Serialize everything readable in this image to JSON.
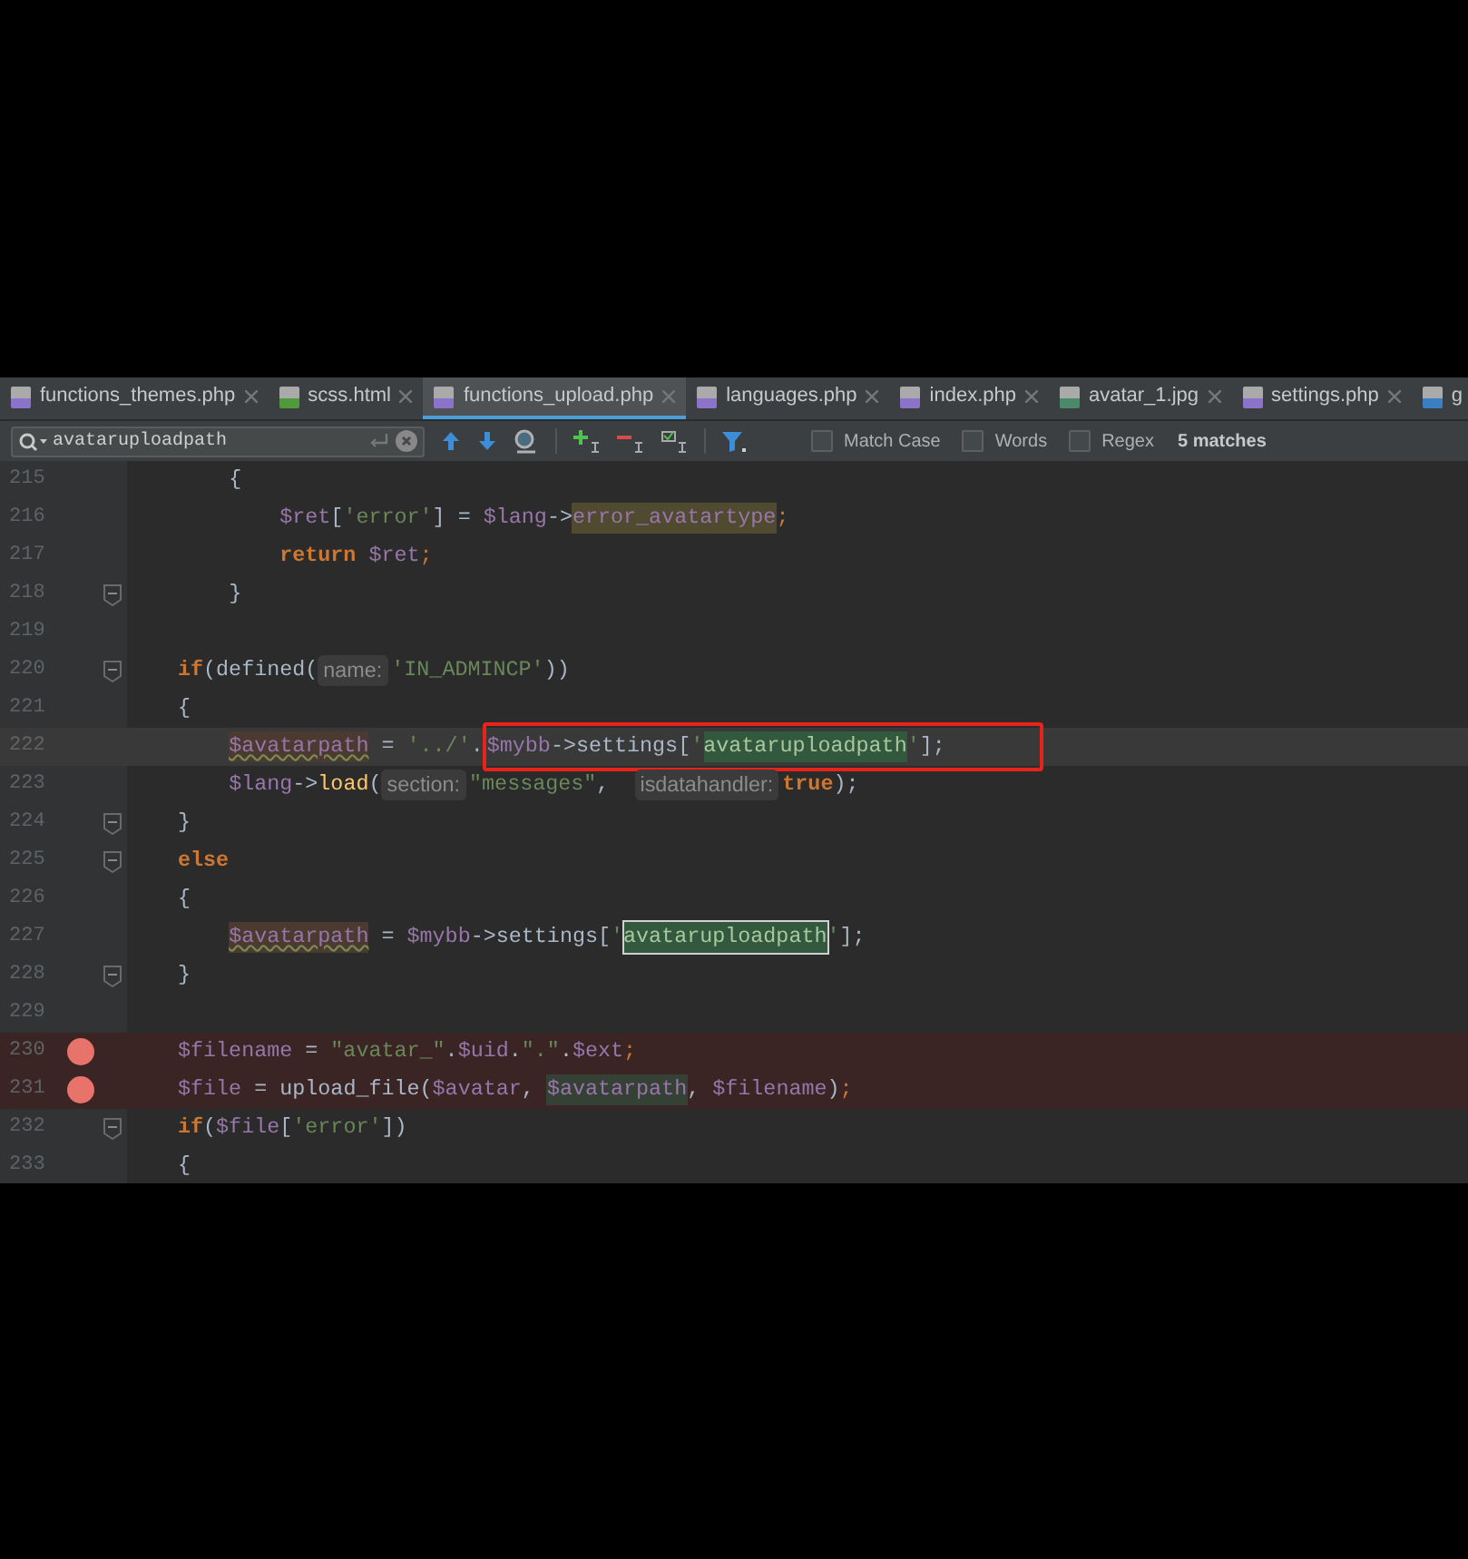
{
  "tabs": [
    {
      "label": "functions_themes.php",
      "kind": "php",
      "selected": false
    },
    {
      "label": "scss.html",
      "kind": "html",
      "selected": false
    },
    {
      "label": "functions_upload.php",
      "kind": "php",
      "selected": true
    },
    {
      "label": "languages.php",
      "kind": "php",
      "selected": false
    },
    {
      "label": "index.php",
      "kind": "php",
      "selected": false
    },
    {
      "label": "avatar_1.jpg",
      "kind": "image",
      "selected": false
    },
    {
      "label": "settings.php",
      "kind": "php",
      "selected": false
    },
    {
      "label": "g",
      "kind": "css",
      "selected": false
    }
  ],
  "find_bar": {
    "query": "avataruploadpath",
    "options": [
      {
        "label": "Match Case",
        "checked": false
      },
      {
        "label": "Words",
        "checked": false
      },
      {
        "label": "Regex",
        "checked": false
      }
    ],
    "matches": "5 matches"
  },
  "code": [
    {
      "number": "215",
      "fold": false,
      "breakpoint": false,
      "current": false,
      "tokens": [
        {
          "kind": "text",
          "text": "    {"
        }
      ]
    },
    {
      "number": "216",
      "fold": false,
      "breakpoint": false,
      "current": false,
      "tokens": [
        {
          "kind": "var",
          "text": "        $ret"
        },
        {
          "kind": "text",
          "text": "["
        },
        {
          "kind": "string",
          "text": "'error'"
        },
        {
          "kind": "text",
          "text": "] = "
        },
        {
          "kind": "var",
          "text": "$lang"
        },
        {
          "kind": "text",
          "text": "->"
        },
        {
          "kind": "unresolved",
          "text": "error_avatartype"
        },
        {
          "kind": "punct",
          "text": ";"
        }
      ]
    },
    {
      "number": "217",
      "fold": false,
      "breakpoint": false,
      "current": false,
      "tokens": [
        {
          "kind": "keyword",
          "text": "        return"
        },
        {
          "kind": "var",
          "text": " $ret"
        },
        {
          "kind": "punct",
          "text": ";"
        }
      ]
    },
    {
      "number": "218",
      "fold": true,
      "breakpoint": false,
      "current": false,
      "tokens": [
        {
          "kind": "text",
          "text": "    }"
        }
      ]
    },
    {
      "number": "219",
      "fold": false,
      "breakpoint": false,
      "current": false
    },
    {
      "number": "220",
      "fold": true,
      "breakpoint": false,
      "current": false,
      "tokens": [
        {
          "kind": "keyword",
          "text": "if"
        },
        {
          "kind": "text",
          "text": "(defined("
        },
        {
          "kind": "hint",
          "text": "name:"
        },
        {
          "kind": "string",
          "text": "'IN_ADMINCP'"
        },
        {
          "kind": "text",
          "text": "))"
        }
      ]
    },
    {
      "number": "221",
      "fold": false,
      "breakpoint": false,
      "current": false,
      "tokens": [
        {
          "kind": "text",
          "text": "{"
        }
      ]
    },
    {
      "number": "222",
      "fold": false,
      "breakpoint": false,
      "current": true,
      "tokens": [
        {
          "kind": "warn_var",
          "text": "    $avatarpath"
        },
        {
          "kind": "text",
          "text": " = "
        },
        {
          "kind": "string",
          "text": "'../'"
        },
        {
          "kind": "text",
          "text": "."
        }
      ],
      "framed_tokens": [
        {
          "kind": "var",
          "text": "$mybb"
        },
        {
          "kind": "text",
          "text": "->settings["
        },
        {
          "kind": "string",
          "text": "'"
        },
        {
          "kind": "match",
          "text": "avataruploadpath",
          "selected": false
        },
        {
          "kind": "string",
          "text": "'"
        },
        {
          "kind": "text",
          "text": "];"
        }
      ]
    },
    {
      "number": "223",
      "fold": false,
      "breakpoint": false,
      "current": false,
      "tokens": [
        {
          "kind": "var",
          "text": "    $lang"
        },
        {
          "kind": "text",
          "text": "->"
        },
        {
          "kind": "method",
          "text": "load"
        },
        {
          "kind": "text",
          "text": "("
        },
        {
          "kind": "hint",
          "text": "section:"
        },
        {
          "kind": "string",
          "text": "\"messages\""
        },
        {
          "kind": "text",
          "text": ",  "
        },
        {
          "kind": "hint",
          "text": "isdatahandler:"
        },
        {
          "kind": "keyword",
          "text": "true"
        },
        {
          "kind": "text",
          "text": ");"
        }
      ]
    },
    {
      "number": "224",
      "fold": true,
      "breakpoint": false,
      "current": false,
      "tokens": [
        {
          "kind": "text",
          "text": "}"
        }
      ]
    },
    {
      "number": "225",
      "fold": true,
      "breakpoint": false,
      "current": false,
      "tokens": [
        {
          "kind": "keyword",
          "text": "else"
        }
      ]
    },
    {
      "number": "226",
      "fold": false,
      "breakpoint": false,
      "current": false,
      "tokens": [
        {
          "kind": "text",
          "text": "{"
        }
      ]
    },
    {
      "number": "227",
      "fold": false,
      "breakpoint": false,
      "current": false,
      "tokens": [
        {
          "kind": "warn_var",
          "text": "    $avatarpath"
        },
        {
          "kind": "text",
          "text": " = "
        },
        {
          "kind": "var",
          "text": "$mybb"
        },
        {
          "kind": "text",
          "text": "->settings["
        },
        {
          "kind": "string",
          "text": "'"
        },
        {
          "kind": "match",
          "text": "avataruploadpath",
          "selected": true
        },
        {
          "kind": "string",
          "text": "'"
        },
        {
          "kind": "text",
          "text": "];"
        }
      ]
    },
    {
      "number": "228",
      "fold": true,
      "breakpoint": false,
      "current": false,
      "tokens": [
        {
          "kind": "text",
          "text": "}"
        }
      ]
    },
    {
      "number": "229",
      "fold": false,
      "breakpoint": false,
      "current": false
    },
    {
      "number": "230",
      "fold": false,
      "breakpoint": true,
      "current": false,
      "tokens": [
        {
          "kind": "var",
          "text": "$filename"
        },
        {
          "kind": "text",
          "text": " = "
        },
        {
          "kind": "string",
          "text": "\"avatar_\""
        },
        {
          "kind": "text",
          "text": "."
        },
        {
          "kind": "var",
          "text": "$uid"
        },
        {
          "kind": "text",
          "text": "."
        },
        {
          "kind": "string",
          "text": "\".\""
        },
        {
          "kind": "text",
          "text": "."
        },
        {
          "kind": "var",
          "text": "$ext"
        },
        {
          "kind": "punct",
          "text": ";"
        }
      ]
    },
    {
      "number": "231",
      "fold": false,
      "breakpoint": true,
      "current": false,
      "tokens": [
        {
          "kind": "var",
          "text": "$file"
        },
        {
          "kind": "text",
          "text": " = upload_file("
        },
        {
          "kind": "var",
          "text": "$avatar"
        },
        {
          "kind": "text",
          "text": ", "
        },
        {
          "kind": "usage",
          "text": "$avatarpath"
        },
        {
          "kind": "text",
          "text": ", "
        },
        {
          "kind": "var",
          "text": "$filename"
        },
        {
          "kind": "text",
          "text": ")"
        },
        {
          "kind": "punct",
          "text": ";"
        }
      ]
    },
    {
      "number": "232",
      "fold": true,
      "breakpoint": false,
      "current": false,
      "tokens": [
        {
          "kind": "keyword",
          "text": "if"
        },
        {
          "kind": "text",
          "text": "("
        },
        {
          "kind": "var",
          "text": "$file"
        },
        {
          "kind": "text",
          "text": "["
        },
        {
          "kind": "string",
          "text": "'error'"
        },
        {
          "kind": "text",
          "text": "])"
        }
      ]
    },
    {
      "number": "233",
      "fold": false,
      "breakpoint": false,
      "current": false,
      "tokens": [
        {
          "kind": "text",
          "text": "{"
        }
      ]
    }
  ]
}
